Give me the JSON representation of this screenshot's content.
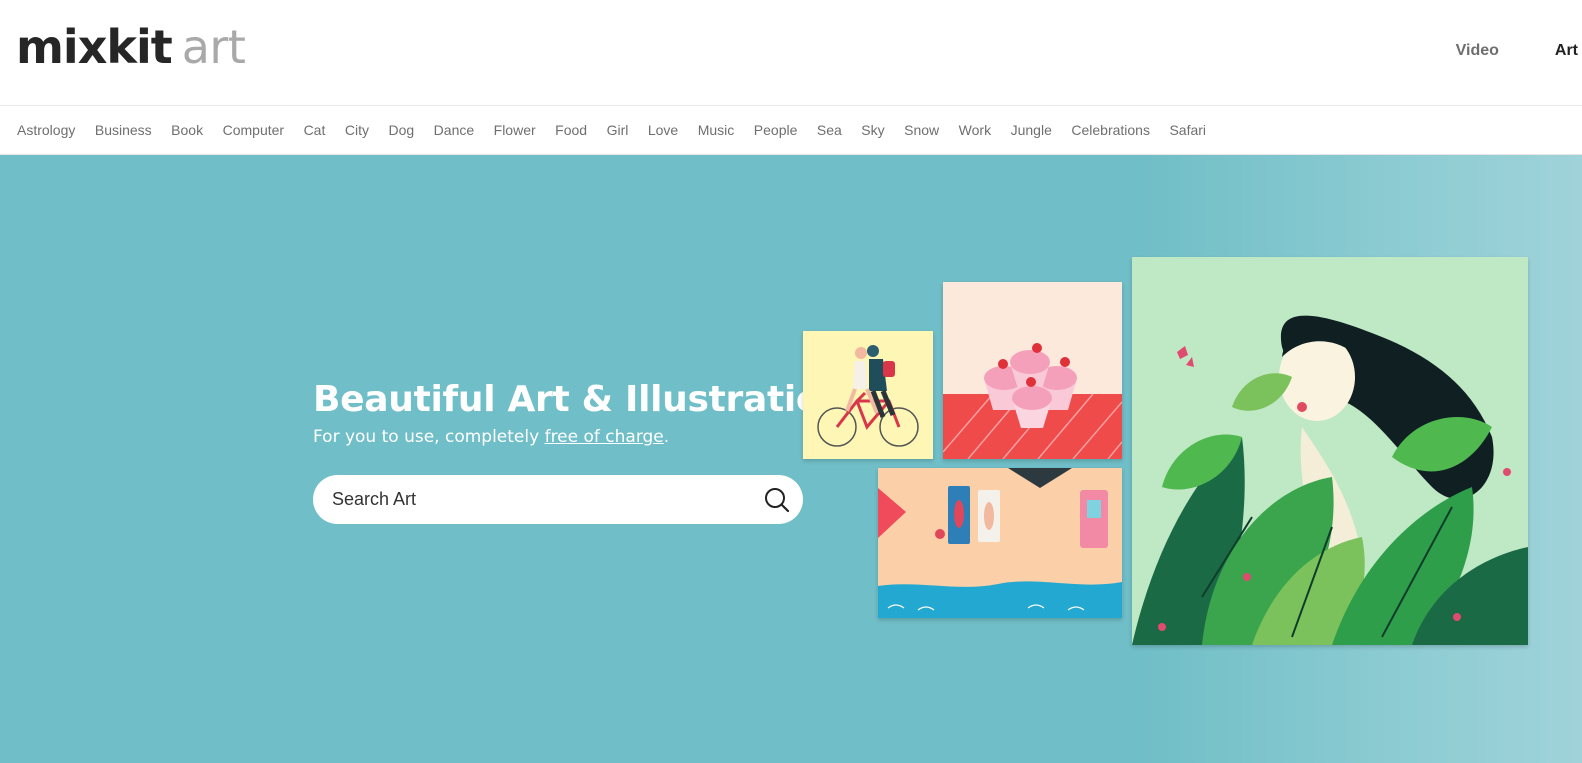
{
  "logo": {
    "word": "mixkit",
    "product": "art"
  },
  "topnav": {
    "video": "Video",
    "art": "Art"
  },
  "categories": [
    "Astrology",
    "Business",
    "Book",
    "Computer",
    "Cat",
    "City",
    "Dog",
    "Dance",
    "Flower",
    "Food",
    "Girl",
    "Love",
    "Music",
    "People",
    "Sea",
    "Sky",
    "Snow",
    "Work",
    "Jungle",
    "Celebrations",
    "Safari"
  ],
  "hero": {
    "title": "Beautiful Art & Illustration",
    "subtitle_prefix": "For you to use, completely ",
    "subtitle_link": "free of charge",
    "subtitle_suffix": ".",
    "search_placeholder": "Search Art",
    "search_icon": "search-icon"
  },
  "colors": {
    "hero_bg": "#70bec7",
    "logo_dark": "#262626",
    "logo_light": "#a9a9a9",
    "category_text": "#6f6f6f"
  }
}
